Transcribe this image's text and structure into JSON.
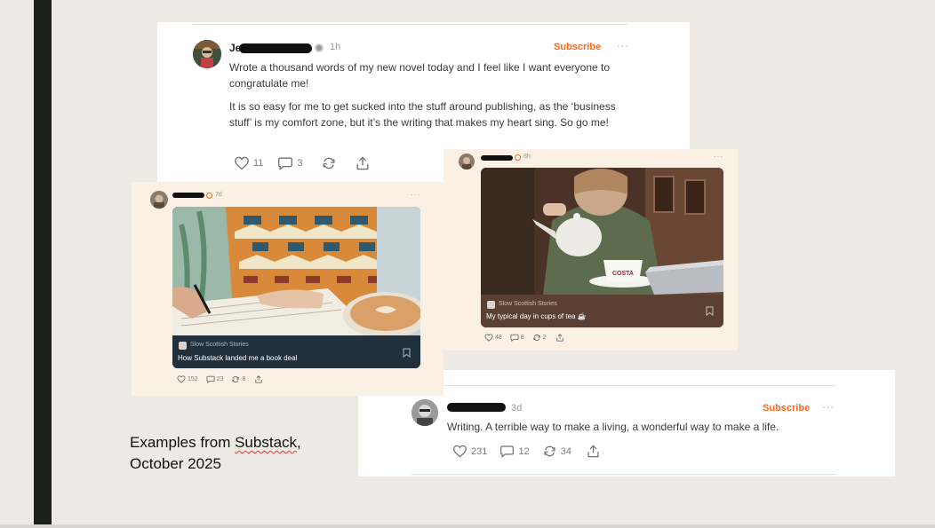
{
  "caption": {
    "line1_prefix": "Examples from ",
    "line1_brand": "Substack",
    "line1_suffix": ",",
    "line2": "October 2025"
  },
  "post_main": {
    "name_visible": "Je",
    "time": "1h",
    "subscribe_label": "Subscribe",
    "more": "···",
    "paragraph1": "Wrote a thousand words of my new novel today and I feel like I want everyone to congratulate me!",
    "paragraph2": "It is so easy for me to get sucked into the stuff around publishing, as the ‘business stuff’ is my comfort zone, but it’s the writing that makes my heart sing. So go me!",
    "likes": "11",
    "comments": "3"
  },
  "post_left": {
    "time": "7d",
    "more": "···",
    "publication": "Slow Scottish Stories",
    "title": "How Substack landed me a book deal",
    "likes": "152",
    "comments": "23",
    "restacks": "8"
  },
  "post_right": {
    "time": "8h",
    "more": "···",
    "publication": "Slow Scottish Stories",
    "title": "My typical day in cups of tea ☕",
    "likes": "48",
    "comments": "8",
    "restacks": "2"
  },
  "post_bottom": {
    "time": "3d",
    "subscribe_label": "Subscribe",
    "more": "···",
    "text": "Writing. A terrible way to make a living, a wonderful way to make a life.",
    "likes": "231",
    "comments": "12",
    "restacks": "34"
  },
  "colors": {
    "accent": "#ff6719",
    "cream": "#faf0e4",
    "page": "#edeae3",
    "side_bar": "#1f1f1a"
  },
  "photos": {
    "left": "person writing in notebook beside latte, patterned fleece",
    "right": "person pouring tea into Costa cup, laptop",
    "cup_text": "COSTA"
  }
}
